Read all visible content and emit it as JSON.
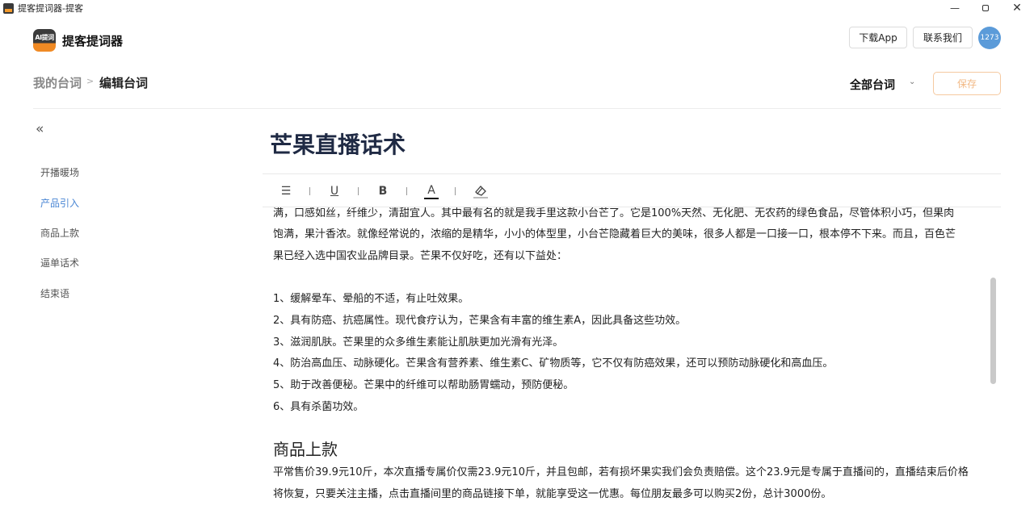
{
  "window": {
    "title": "提客提词器-提客",
    "min": "—",
    "close": "✕"
  },
  "header": {
    "logo_text": "AI提词",
    "brand": "提客提词器",
    "download_label": "下载App",
    "contact_label": "联系我们",
    "avatar_text": "1273"
  },
  "breadcrumb": {
    "root": "我的台词",
    "sep": ">",
    "current": "编辑台词"
  },
  "filter": {
    "label": "全部台词",
    "chevron": "⌄"
  },
  "save_label": "保存",
  "sidebar": {
    "collapse_icon": "«",
    "items": [
      {
        "label": "开播暖场"
      },
      {
        "label": "产品引入"
      },
      {
        "label": "商品上款"
      },
      {
        "label": "逼单话术"
      },
      {
        "label": "结束语"
      }
    ]
  },
  "editor": {
    "title": "芒果直播话术",
    "toolbar": {
      "list": "☰",
      "underline": "U",
      "bold": "B",
      "color": "A",
      "sep": "|"
    },
    "lines": [
      "满，口感如丝，纤维少，清甜宜人。其中最有名的就是我手里这款小台芒了。它是100%天然、无化肥、无农药的绿色食品，尽管体积小巧，但果肉",
      "饱满，果汁香浓。就像经常说的，浓缩的是精华，小小的体型里，小台芒隐藏着巨大的美味，很多人都是一口接一口，根本停不下来。而且，百色芒",
      "果已经入选中国农业品牌目录。芒果不仅好吃，还有以下益处：",
      "1、缓解晕车、晕船的不适，有止吐效果。",
      "2、具有防癌、抗癌属性。现代食疗认为，芒果含有丰富的维生素A，因此具备这些功效。",
      "3、滋润肌肤。芒果里的众多维生素能让肌肤更加光滑有光泽。",
      "4、防治高血压、动脉硬化。芒果含有营养素、维生素C、矿物质等，它不仅有防癌效果，还可以预防动脉硬化和高血压。",
      "5、助于改善便秘。芒果中的纤维可以帮助肠胃蠕动，预防便秘。",
      "6、具有杀菌功效。",
      "平常售价39.9元10斤，本次直播专属价仅需23.9元10斤，并且包邮，若有损坏果实我们会负责赔偿。这个23.9元是专属于直播间的，直播结束后价格",
      "将恢复，只要关注主播，点击直播间里的商品链接下单，就能享受这一优惠。每位朋友最多可以购买2份，总计3000份。"
    ],
    "section_heading": "商品上款"
  }
}
